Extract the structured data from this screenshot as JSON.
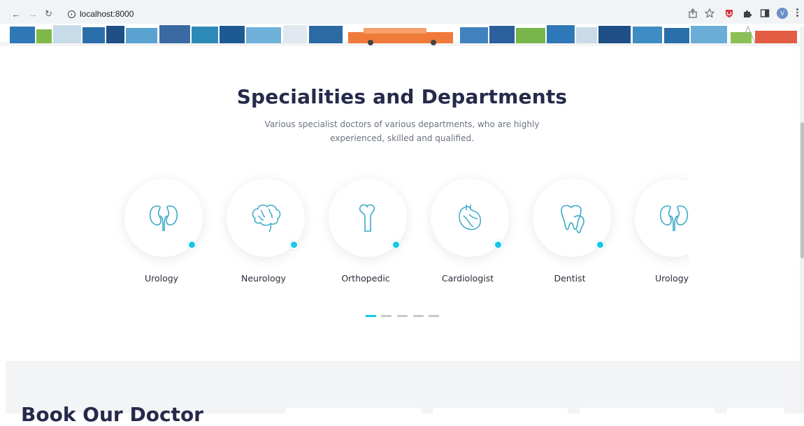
{
  "browser": {
    "url": "localhost:8000",
    "avatar_letter": "V"
  },
  "section": {
    "title": "Specialities and Departments",
    "subtitle": "Various specialist doctors of various departments, who are highly experienced, skilled and qualified."
  },
  "departments": [
    {
      "label": "Urology",
      "icon": "kidney-icon"
    },
    {
      "label": "Neurology",
      "icon": "brain-icon"
    },
    {
      "label": "Orthopedic",
      "icon": "bone-icon"
    },
    {
      "label": "Cardiologist",
      "icon": "heart-icon"
    },
    {
      "label": "Dentist",
      "icon": "tooth-icon"
    },
    {
      "label": "Urology",
      "icon": "kidney-icon"
    }
  ],
  "pager": {
    "count": 5,
    "active_index": 0
  },
  "lower": {
    "title": "Book Our Doctor"
  },
  "colors": {
    "accent": "#17c7ea",
    "heading": "#262a4a",
    "icon_stroke": "#3ca9c8"
  }
}
